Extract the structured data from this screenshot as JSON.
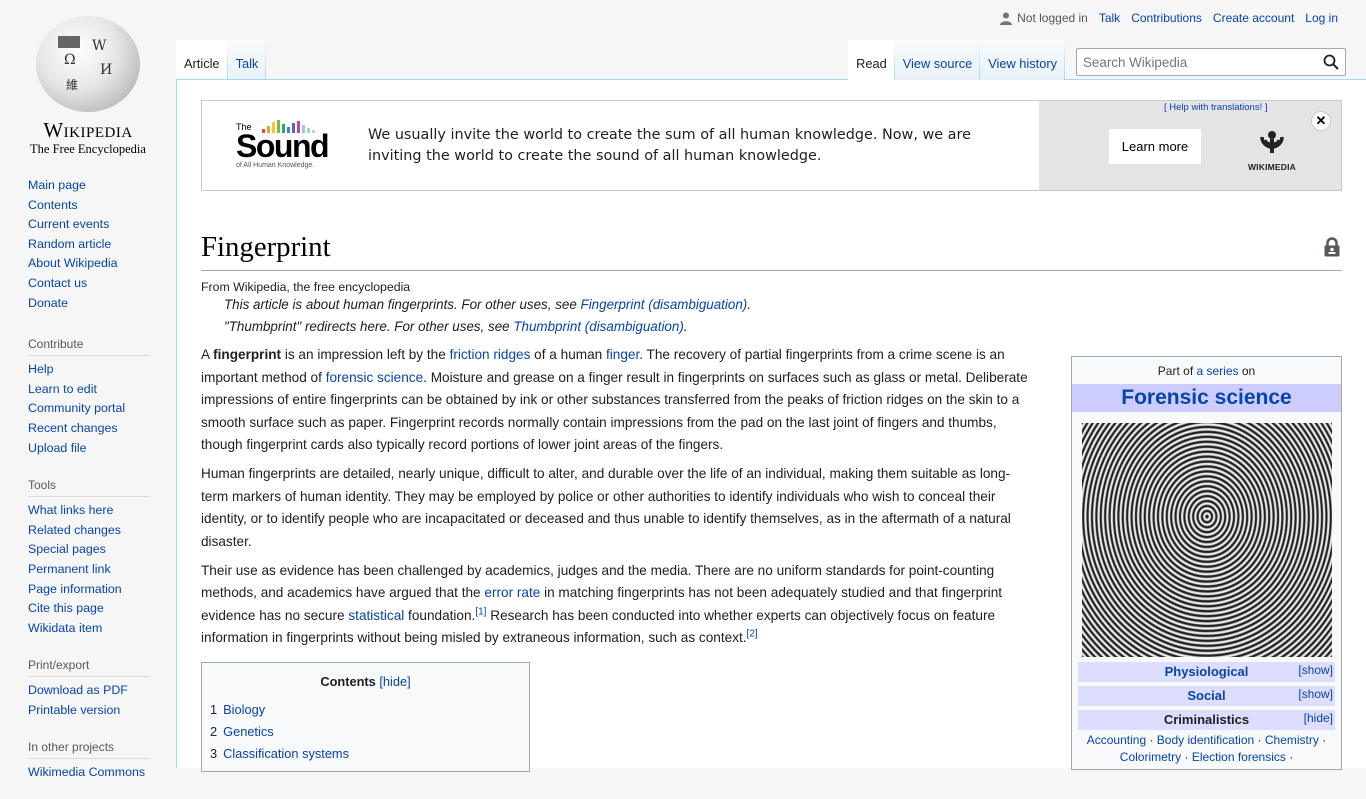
{
  "logo": {
    "wordmark": "Wikipedia",
    "tagline": "The Free Encyclopedia"
  },
  "personal": {
    "status": "Not logged in",
    "links": [
      "Talk",
      "Contributions",
      "Create account",
      "Log in"
    ]
  },
  "namespaces": [
    {
      "label": "Article",
      "selected": true
    },
    {
      "label": "Talk",
      "selected": false
    }
  ],
  "views": [
    {
      "label": "Read",
      "selected": true
    },
    {
      "label": "View source",
      "selected": false
    },
    {
      "label": "View history",
      "selected": false
    }
  ],
  "search": {
    "placeholder": "Search Wikipedia",
    "value": ""
  },
  "sidebar": {
    "navigation": [
      "Main page",
      "Contents",
      "Current events",
      "Random article",
      "About Wikipedia",
      "Contact us",
      "Donate"
    ],
    "contribute": {
      "heading": "Contribute",
      "items": [
        "Help",
        "Learn to edit",
        "Community portal",
        "Recent changes",
        "Upload file"
      ]
    },
    "tools": {
      "heading": "Tools",
      "items": [
        "What links here",
        "Related changes",
        "Special pages",
        "Permanent link",
        "Page information",
        "Cite this page",
        "Wikidata item"
      ]
    },
    "print": {
      "heading": "Print/export",
      "items": [
        "Download as PDF",
        "Printable version"
      ]
    },
    "projects": {
      "heading": "In other projects",
      "items": [
        "Wikimedia Commons"
      ]
    }
  },
  "banner": {
    "logo_the": "The",
    "logo_word": "Sound",
    "logo_sub": "of All Human Knowledge.",
    "message": "We usually invite the world to create the sum of all human knowledge. Now, we are inviting the world to create the sound of all human knowledge.",
    "help_link": "[ Help with translations! ]",
    "learn_more": "Learn more",
    "wikimedia": "WIKIMEDIA",
    "bar_colors": [
      "#e8463b",
      "#f39c2b",
      "#f5c924",
      "#7bb942",
      "#2aa47a",
      "#3588c9",
      "#6a5bb5",
      "#c54a8c",
      "#9dc7e4",
      "#a8d6b3",
      "#cfcfcf"
    ]
  },
  "article": {
    "title": "Fingerprint",
    "site_sub": "From Wikipedia, the free encyclopedia",
    "hatnotes": [
      {
        "text": "This article is about human fingerprints. For other uses, see ",
        "link": "Fingerprint (disambiguation)",
        "end": "."
      },
      {
        "text": "\"Thumbprint\" redirects here. For other uses, see ",
        "link": "Thumbprint (disambiguation)",
        "end": "."
      }
    ],
    "p1": {
      "a": "A ",
      "bold": "fingerprint",
      "b": " is an impression left by the ",
      "l1": "friction ridges",
      "c": " of a human ",
      "l2": "finger",
      "d": ". The recovery of partial fingerprints from a crime scene is an important method of ",
      "l3": "forensic science",
      "e": ". Moisture and grease on a finger result in fingerprints on surfaces such as glass or metal. Deliberate impressions of entire fingerprints can be obtained by ink or other substances transferred from the peaks of friction ridges on the skin to a smooth surface such as paper. Fingerprint records normally contain impressions from the pad on the last joint of fingers and thumbs, though fingerprint cards also typically record portions of lower joint areas of the fingers."
    },
    "p2": "Human fingerprints are detailed, nearly unique, difficult to alter, and durable over the life of an individual, making them suitable as long-term markers of human identity. They may be employed by police or other authorities to identify individuals who wish to conceal their identity, or to identify people who are incapacitated or deceased and thus unable to identify themselves, as in the aftermath of a natural disaster.",
    "p3": {
      "a": "Their use as evidence has been challenged by academics, judges and the media. There are no uniform standards for point-counting methods, and academics have argued that the ",
      "l1": "error rate",
      "b": " in matching fingerprints has not been adequately studied and that fingerprint evidence has no secure ",
      "l2": "statistical",
      "c": " foundation.",
      "ref1": "[1]",
      "d": " Research has been conducted into whether experts can objectively focus on feature information in fingerprints without being misled by extraneous information, such as context.",
      "ref2": "[2]"
    }
  },
  "toc": {
    "title": "Contents",
    "toggle": "[hide]",
    "items": [
      {
        "num": "1",
        "label": "Biology"
      },
      {
        "num": "2",
        "label": "Genetics"
      },
      {
        "num": "3",
        "label": "Classification systems"
      }
    ]
  },
  "infobox": {
    "pre_a": "Part of ",
    "pre_link": "a series",
    "pre_b": " on",
    "title": "Forensic science",
    "sections": [
      {
        "label": "Physiological",
        "toggle": "[show]"
      },
      {
        "label": "Social",
        "toggle": "[show]"
      },
      {
        "label": "Criminalistics",
        "toggle": "[hide]"
      }
    ],
    "criminalistics_items": [
      "Accounting",
      "Body identification",
      "Chemistry",
      "Colorimetry",
      "Election forensics"
    ]
  }
}
